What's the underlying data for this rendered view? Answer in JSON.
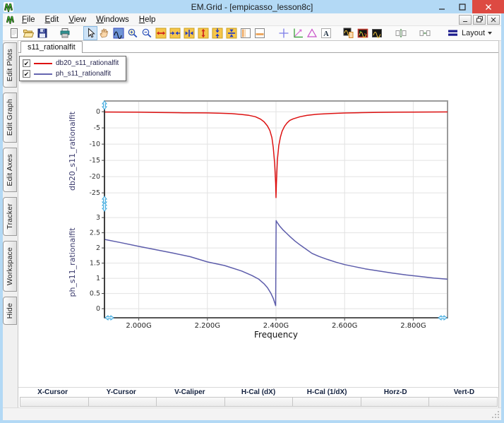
{
  "window": {
    "title": "EM.Grid - [empicasso_lesson8c]"
  },
  "menubar": {
    "items": [
      {
        "label": "File"
      },
      {
        "label": "Edit"
      },
      {
        "label": "View"
      },
      {
        "label": "Windows"
      },
      {
        "label": "Help"
      }
    ]
  },
  "toolbar": {
    "items": [
      {
        "name": "new-button",
        "icon": "page"
      },
      {
        "name": "open-button",
        "icon": "folder"
      },
      {
        "name": "save-button",
        "icon": "floppy"
      },
      {
        "name": "print-button",
        "icon": "printer",
        "gap": 12
      },
      {
        "name": "pointer-tool",
        "icon": "cursor",
        "gap": 16,
        "active": true
      },
      {
        "name": "pan-tool",
        "icon": "hand"
      },
      {
        "name": "plot-select-tool",
        "icon": "waveblue"
      },
      {
        "name": "zoom-in-tool",
        "icon": "zoomin"
      },
      {
        "name": "zoom-out-tool",
        "icon": "zoomout"
      },
      {
        "name": "h-expand-tool",
        "icon": "hexpand"
      },
      {
        "name": "h-shrink-tool",
        "icon": "hshrink"
      },
      {
        "name": "h-center-tool",
        "icon": "hcenter"
      },
      {
        "name": "v-expand-tool",
        "icon": "vexpand"
      },
      {
        "name": "v-shrink-tool",
        "icon": "vshrink"
      },
      {
        "name": "v-center-tool",
        "icon": "vcenter"
      },
      {
        "name": "split-vertical-tool",
        "icon": "panelv"
      },
      {
        "name": "split-horizontal-tool",
        "icon": "panelh"
      },
      {
        "name": "crosshair-tool",
        "icon": "crosshair",
        "gap": 14
      },
      {
        "name": "axes-marker-tool",
        "icon": "axes"
      },
      {
        "name": "delta-marker-tool",
        "icon": "delta"
      },
      {
        "name": "text-annotation-tool",
        "icon": "textA"
      },
      {
        "name": "clip-waveform-tool",
        "icon": "waveclip",
        "gap": 12
      },
      {
        "name": "waveform-window-tool",
        "icon": "wavered"
      },
      {
        "name": "waveform-overlay-tool",
        "icon": "wavedark"
      },
      {
        "name": "align-vertical-tool",
        "icon": "boxesv",
        "gap": 14
      },
      {
        "name": "align-horizontal-tool",
        "icon": "boxesh",
        "gap": 14
      },
      {
        "name": "layout-menu-button",
        "icon": "layoutlines",
        "label": "Layout",
        "dropdown": true,
        "gap": 16
      }
    ]
  },
  "sidebar": {
    "tabs": [
      {
        "label": "Edit Plots"
      },
      {
        "label": "Edit Graph"
      },
      {
        "label": "Edit Axes"
      },
      {
        "label": "Tracker"
      },
      {
        "label": "Workspace"
      },
      {
        "label": "Hide"
      }
    ]
  },
  "document_tab": {
    "label": "s11_rationalfit"
  },
  "legend": {
    "entries": [
      {
        "label": "db20_s11_rationalfit",
        "color": "#dd1111",
        "checked": true
      },
      {
        "label": "ph_s11_rationalfit",
        "color": "#6565b0",
        "checked": true
      }
    ]
  },
  "chart_data": [
    {
      "type": "line",
      "title": "",
      "ylabel": "db20_s11_rationalfit",
      "xlabel": "",
      "xlim": [
        1.9,
        2.9
      ],
      "ylim": [
        -27.6,
        3.3
      ],
      "yticks": [
        0,
        -5,
        -10,
        -15,
        -20,
        -25
      ],
      "ytick_labels": [
        "0",
        "-5",
        "-10",
        "-15",
        "-20",
        "-25"
      ],
      "xticks": [
        2.0,
        2.2,
        2.4,
        2.6,
        2.8
      ],
      "xtick_labels": [
        "2.000G",
        "2.200G",
        "2.400G",
        "2.600G",
        "2.800G"
      ],
      "grid": true,
      "series": [
        {
          "name": "db20_s11_rationalfit",
          "color": "#dd1111",
          "x": [
            1.9,
            1.95,
            2.0,
            2.05,
            2.1,
            2.13,
            2.16,
            2.2,
            2.24,
            2.27,
            2.3,
            2.32,
            2.34,
            2.355,
            2.365,
            2.375,
            2.382,
            2.388,
            2.392,
            2.396,
            2.399,
            2.4,
            2.401,
            2.404,
            2.408,
            2.413,
            2.418,
            2.425,
            2.432,
            2.44,
            2.45,
            2.47,
            2.49,
            2.52,
            2.56,
            2.6,
            2.65,
            2.7,
            2.75,
            2.8,
            2.85,
            2.9
          ],
          "y": [
            -0.1,
            -0.12,
            -0.15,
            -0.22,
            -0.3,
            -0.33,
            -0.35,
            -0.38,
            -0.48,
            -0.6,
            -0.85,
            -1.1,
            -1.55,
            -2.3,
            -3.1,
            -4.4,
            -5.8,
            -8.0,
            -11.0,
            -16.0,
            -22.0,
            -26.5,
            -22.5,
            -15.0,
            -10.5,
            -7.8,
            -6.0,
            -4.5,
            -3.5,
            -2.7,
            -2.2,
            -1.55,
            -1.15,
            -0.8,
            -0.55,
            -0.4,
            -0.28,
            -0.2,
            -0.15,
            -0.12,
            -0.1,
            -0.08
          ]
        }
      ]
    },
    {
      "type": "line",
      "title": "",
      "ylabel": "ph_s11_rationalfit",
      "xlabel": "Frequency",
      "xlim": [
        1.9,
        2.9
      ],
      "ylim": [
        -0.3,
        3.35
      ],
      "yticks": [
        0,
        0.5,
        1,
        1.5,
        2,
        2.5,
        3
      ],
      "ytick_labels": [
        "0",
        "0.5",
        "1",
        "1.5",
        "2",
        "2.5",
        "3"
      ],
      "xticks": [
        2.0,
        2.2,
        2.4,
        2.6,
        2.8
      ],
      "xtick_labels": [
        "2.000G",
        "2.200G",
        "2.400G",
        "2.600G",
        "2.800G"
      ],
      "grid": true,
      "series": [
        {
          "name": "ph_s11_rationalfit",
          "color": "#5d5dab",
          "x": [
            1.9,
            1.95,
            2.0,
            2.05,
            2.1,
            2.15,
            2.2,
            2.25,
            2.3,
            2.33,
            2.35,
            2.365,
            2.375,
            2.385,
            2.392,
            2.396,
            2.399,
            2.4005,
            2.402,
            2.41,
            2.42,
            2.43,
            2.442,
            2.455,
            2.47,
            2.49,
            2.505,
            2.525,
            2.55,
            2.575,
            2.6,
            2.63,
            2.66,
            2.7,
            2.74,
            2.78,
            2.82,
            2.86,
            2.9
          ],
          "y": [
            2.28,
            2.17,
            2.05,
            1.94,
            1.83,
            1.71,
            1.54,
            1.42,
            1.24,
            1.09,
            0.97,
            0.82,
            0.69,
            0.51,
            0.34,
            0.2,
            0.1,
            2.9,
            2.86,
            2.73,
            2.6,
            2.49,
            2.36,
            2.23,
            2.1,
            1.94,
            1.82,
            1.72,
            1.62,
            1.53,
            1.45,
            1.38,
            1.31,
            1.24,
            1.17,
            1.11,
            1.06,
            1.01,
            0.97
          ]
        }
      ]
    }
  ],
  "cursor_bar": {
    "columns": [
      "X-Cursor",
      "Y-Cursor",
      "V-Caliper",
      "H-Cal (dX)",
      "H-Cal (1/dX)",
      "Horz-D",
      "Vert-D"
    ],
    "values": [
      "",
      "",
      "",
      "",
      "",
      "",
      ""
    ]
  },
  "colors": {
    "titlebar": "#b3d9f5",
    "close_button": "#dd4a42",
    "curve_db20": "#dd1111",
    "curve_ph": "#5d5dab",
    "grid_line": "#e2e2e2",
    "handle": "#3aa7dd"
  }
}
